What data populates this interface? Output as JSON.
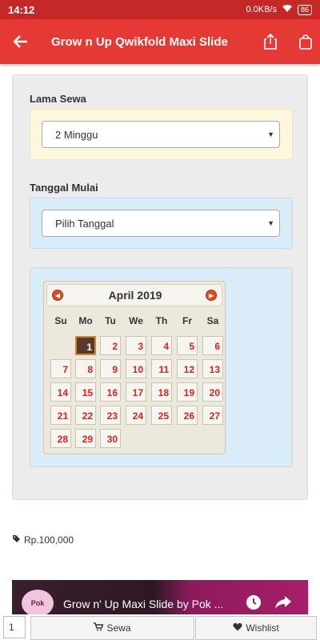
{
  "status": {
    "time": "14:12",
    "network": "0.0KB/s",
    "battery": "86"
  },
  "appbar": {
    "title": "Grow n Up Qwikfold Maxi Slide"
  },
  "form": {
    "lama_sewa_label": "Lama Sewa",
    "lama_sewa_value": "2 Minggu",
    "tanggal_label": "Tanggal Mulai",
    "tanggal_placeholder": "Pilih Tanggal"
  },
  "calendar": {
    "month_title": "April 2019",
    "weekdays": [
      "Su",
      "Mo",
      "Tu",
      "We",
      "Th",
      "Fr",
      "Sa"
    ],
    "selected_day": "1",
    "weeks": [
      [
        "",
        "1",
        "2",
        "3",
        "4",
        "5",
        "6"
      ],
      [
        "7",
        "8",
        "9",
        "10",
        "11",
        "12",
        "13"
      ],
      [
        "14",
        "15",
        "16",
        "17",
        "18",
        "19",
        "20"
      ],
      [
        "21",
        "22",
        "23",
        "24",
        "25",
        "26",
        "27"
      ],
      [
        "28",
        "29",
        "30",
        "",
        "",
        "",
        ""
      ]
    ]
  },
  "price": "Rp.100,000",
  "video": {
    "logo_text": "Pok",
    "title": "Grow n' Up Maxi Slide by Pok ..."
  },
  "bottom": {
    "qty": "1",
    "sewa_label": "Sewa",
    "wishlist_label": "Wishlist"
  },
  "colors": {
    "appbar": "#e53935",
    "day_text": "#e0201a",
    "selected_bg": "#5a3a2a"
  }
}
